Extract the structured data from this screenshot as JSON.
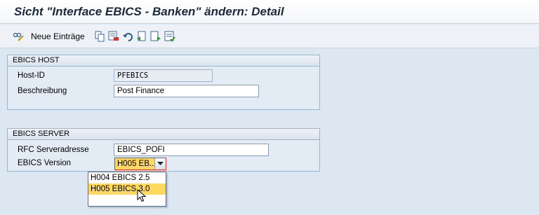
{
  "window": {
    "title": "Sicht \"Interface EBICS - Banken\" ändern: Detail"
  },
  "toolbar": {
    "new_entries_label": "Neue Einträge",
    "icons": [
      "glasses-pen-icon",
      "copy-icon",
      "delete-icon",
      "undo-icon",
      "previous-entry-icon",
      "next-entry-icon",
      "select-all-icon"
    ]
  },
  "host_group": {
    "title": "EBICS HOST",
    "host_id_label": "Host-ID",
    "host_id_value": "PFEBICS",
    "description_label": "Beschreibung",
    "description_value": "Post Finance"
  },
  "server_group": {
    "title": "EBICS SERVER",
    "rfc_label": "RFC Serveradresse",
    "rfc_value": "EBICS_POFI",
    "version_label": "EBICS Version",
    "version_value": "H005 EB..."
  },
  "dropdown": {
    "options": [
      {
        "label": "H004 EBICS 2.5",
        "selected": false
      },
      {
        "label": "H005 EBICS 3.0",
        "selected": true
      }
    ]
  },
  "colors": {
    "accent_yellow": "#ffd85e",
    "required_border": "#d4342c",
    "group_border": "#9fb3c9"
  }
}
